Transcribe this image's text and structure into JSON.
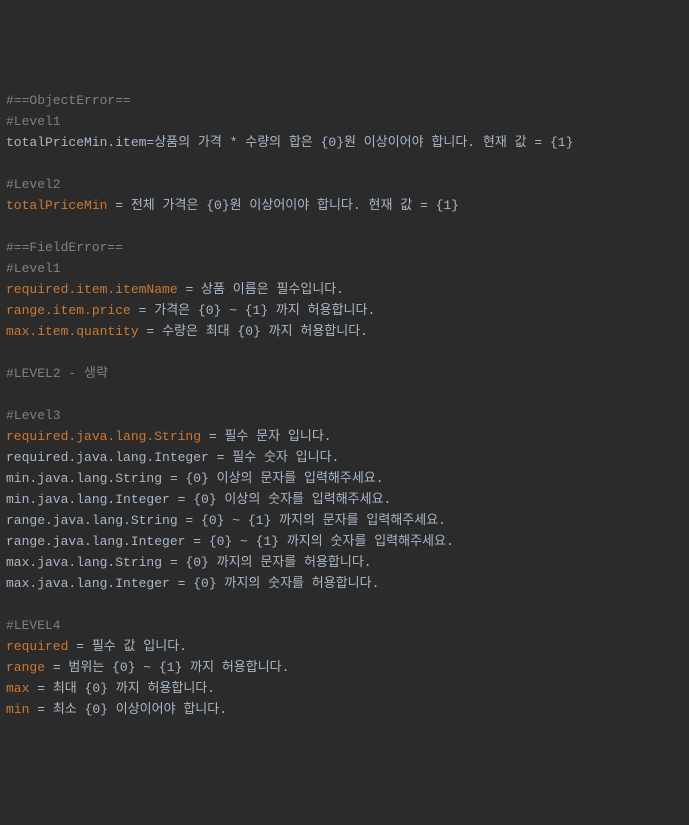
{
  "lines": [
    {
      "type": "comment",
      "comment": "#==ObjectError=="
    },
    {
      "type": "comment",
      "comment": "#Level1"
    },
    {
      "type": "plain",
      "text": "totalPriceMin.item=상품의 가격 * 수량의 합은 {0}원 이상이어야 합니다. 현재 값 = {1}"
    },
    {
      "type": "blank"
    },
    {
      "type": "comment",
      "comment": "#Level2"
    },
    {
      "type": "kv",
      "key": "totalPriceMin",
      "sep": " = ",
      "value": "전체 가격은 {0}원 이상어이야 합니다. 현재 값 = {1}"
    },
    {
      "type": "blank"
    },
    {
      "type": "comment",
      "comment": "#==FieldError=="
    },
    {
      "type": "comment",
      "comment": "#Level1"
    },
    {
      "type": "kv",
      "key": "required.item.itemName",
      "sep": " = ",
      "value": "상품 이름은 필수입니다."
    },
    {
      "type": "kv",
      "key": "range.item.price",
      "sep": " = ",
      "value": "가격은 {0} ~ {1} 까지 허용합니다."
    },
    {
      "type": "kv",
      "key": "max.item.quantity",
      "sep": " = ",
      "value": "수량은 최대 {0} 까지 허용합니다."
    },
    {
      "type": "blank"
    },
    {
      "type": "comment",
      "comment": "#LEVEL2 - 생략"
    },
    {
      "type": "blank"
    },
    {
      "type": "comment",
      "comment": "#Level3"
    },
    {
      "type": "kv",
      "key": "required.java.lang.String",
      "sep": " = ",
      "value": "필수 문자 입니다."
    },
    {
      "type": "plain",
      "text": "required.java.lang.Integer = 필수 숫자 입니다."
    },
    {
      "type": "plain",
      "text": "min.java.lang.String = {0} 이상의 문자를 입력해주세요."
    },
    {
      "type": "plain",
      "text": "min.java.lang.Integer = {0} 이상의 숫자를 입력해주세요."
    },
    {
      "type": "plain",
      "text": "range.java.lang.String = {0} ~ {1} 까지의 문자를 입력해주세요."
    },
    {
      "type": "plain",
      "text": "range.java.lang.Integer = {0} ~ {1} 까지의 숫자를 입력해주세요."
    },
    {
      "type": "plain",
      "text": "max.java.lang.String = {0} 까지의 문자를 허용합니다."
    },
    {
      "type": "plain",
      "text": "max.java.lang.Integer = {0} 까지의 숫자를 허용합니다."
    },
    {
      "type": "blank"
    },
    {
      "type": "comment",
      "comment": "#LEVEL4"
    },
    {
      "type": "kv",
      "key": "required",
      "sep": " = ",
      "value": "필수 값 입니다."
    },
    {
      "type": "kv",
      "key": "range",
      "sep": " = ",
      "value": "범위는 {0} ~ {1} 까지 허용합니다."
    },
    {
      "type": "kv",
      "key": "max",
      "sep": " = ",
      "value": "최대 {0} 까지 허용합니다."
    },
    {
      "type": "kv",
      "key": "min",
      "sep": " = ",
      "value": "최소 {0} 이상이어야 합니다."
    }
  ]
}
